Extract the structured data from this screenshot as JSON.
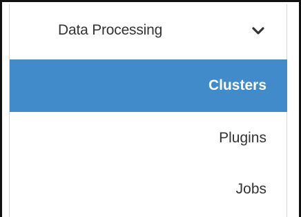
{
  "sidebar": {
    "section": {
      "title": "Data Processing",
      "icon": "chevron-down-icon",
      "expanded": true
    },
    "items": [
      {
        "label": "Clusters",
        "active": true
      },
      {
        "label": "Plugins",
        "active": false
      },
      {
        "label": "Jobs",
        "active": false
      }
    ]
  },
  "colors": {
    "active_background": "#428bca",
    "active_text": "#ffffff",
    "text": "#333333"
  }
}
